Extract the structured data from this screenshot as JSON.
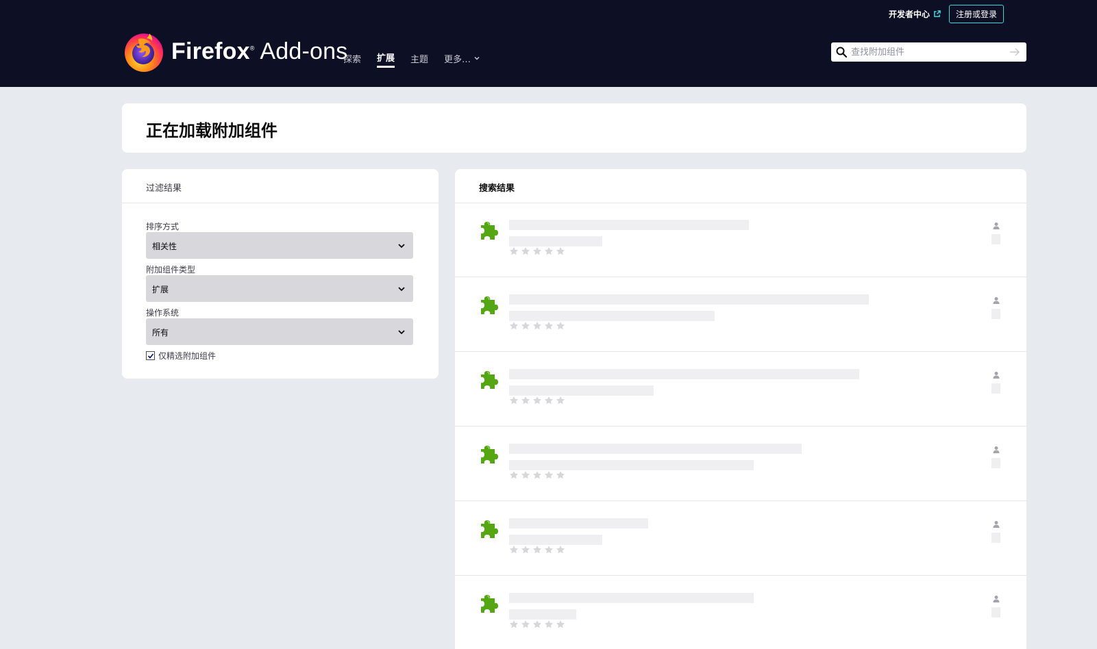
{
  "header": {
    "dev_hub": "开发者中心",
    "login": "注册或登录",
    "logo_name": "Firefox",
    "logo_suffix": "Add-ons",
    "nav": [
      "探索",
      "扩展",
      "主题",
      "更多…"
    ],
    "search_placeholder": "查找附加组件"
  },
  "title": "正在加载附加组件",
  "filters": {
    "heading": "过滤结果",
    "sort_label": "排序方式",
    "sort_value": "相关性",
    "type_label": "附加组件类型",
    "type_value": "扩展",
    "os_label": "操作系统",
    "os_value": "所有",
    "recommended_label": "仅精选附加组件",
    "recommended_checked": true
  },
  "results": {
    "heading": "搜索结果",
    "placeholder_rows": 6
  },
  "colors": {
    "header_bg": "#0d0f24",
    "page_bg": "#e7eaee",
    "accent": "#38d9e3",
    "puzzle_green": "#54a612",
    "skeleton": "#efeff1"
  }
}
